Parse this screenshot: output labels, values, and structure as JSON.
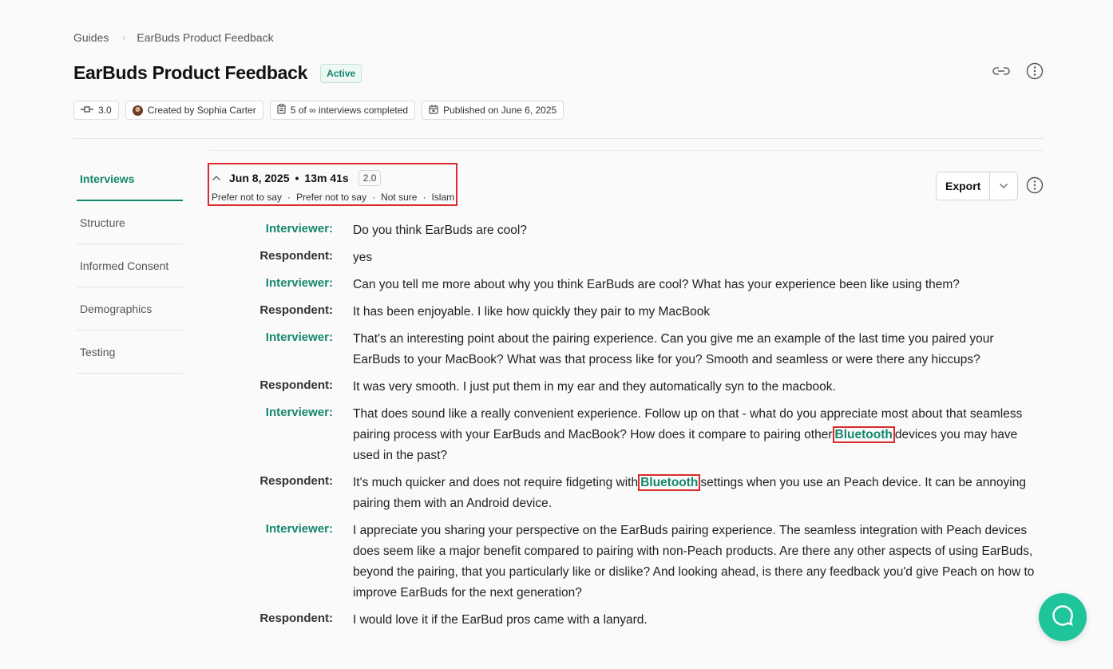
{
  "breadcrumb": {
    "root": "Guides",
    "current": "EarBuds Product Feedback"
  },
  "page": {
    "title": "EarBuds Product Feedback",
    "status": "Active"
  },
  "meta": {
    "version": "3.0",
    "created_by": "Created by Sophia Carter",
    "interviews": "5 of ∞ interviews completed",
    "published": "Published on June 6, 2025"
  },
  "nav": {
    "items": [
      "Interviews",
      "Structure",
      "Informed Consent",
      "Demographics",
      "Testing"
    ],
    "active": "Interviews"
  },
  "interview": {
    "date": "Jun 8, 2025",
    "duration": "13m 41s",
    "version": "2.0",
    "demographics": [
      "Prefer not to say",
      "Prefer not to say",
      "Not sure",
      "Islam"
    ]
  },
  "actions": {
    "export_label": "Export"
  },
  "transcript": [
    {
      "speaker": "Interviewer:",
      "role": "interviewer",
      "parts": [
        "Do you think EarBuds are cool?"
      ]
    },
    {
      "speaker": "Respondent:",
      "role": "respondent",
      "parts": [
        "yes"
      ]
    },
    {
      "speaker": "Interviewer:",
      "role": "interviewer",
      "parts": [
        "Can you tell me more about why you think EarBuds are cool? What has your experience been like using them?"
      ]
    },
    {
      "speaker": "Respondent:",
      "role": "respondent",
      "parts": [
        "It has been enjoyable. I like how quickly they pair to my MacBook"
      ]
    },
    {
      "speaker": "Interviewer:",
      "role": "interviewer",
      "parts": [
        "That's an interesting point about the pairing experience. Can you give me an example of the last time you paired your EarBuds to your MacBook? What was that process like for you? Smooth and seamless or were there any hiccups?"
      ]
    },
    {
      "speaker": "Respondent:",
      "role": "respondent",
      "parts": [
        "It was very smooth. I just put them in my ear and they automatically syn to the macbook."
      ]
    },
    {
      "speaker": "Interviewer:",
      "role": "interviewer",
      "parts": [
        "That does sound like a really convenient experience. Follow up on that - what do you appreciate most about that seamless pairing process with your EarBuds and MacBook? How does it compare to pairing other",
        "Bluetooth",
        "devices you may have used in the past?"
      ]
    },
    {
      "speaker": "Respondent:",
      "role": "respondent",
      "parts": [
        "It's much quicker and does not require fidgeting with",
        "Bluetooth",
        "settings when you use an Peach device. It can be annoying pairing them with an Android device."
      ]
    },
    {
      "speaker": "Interviewer:",
      "role": "interviewer",
      "parts": [
        "I appreciate you sharing your perspective on the EarBuds pairing experience. The seamless integration with Peach devices does seem like a major benefit compared to pairing with non-Peach products. Are there any other aspects of using EarBuds, beyond the pairing, that you particularly like or dislike? And looking ahead, is there any feedback you'd give Peach on how to improve EarBuds for the next generation?"
      ]
    },
    {
      "speaker": "Respondent:",
      "role": "respondent",
      "parts": [
        "I would love it if the EarBud pros came with a lanyard."
      ]
    }
  ],
  "colors": {
    "accent": "#14866d",
    "highlight_border": "#d92b2b",
    "fab": "#1fc49a"
  },
  "icons": [
    "link-icon",
    "more-vertical-icon",
    "version-icon",
    "calendar-icon",
    "clipboard-icon",
    "chevron-up-icon",
    "chevron-down-icon",
    "chat-icon"
  ]
}
